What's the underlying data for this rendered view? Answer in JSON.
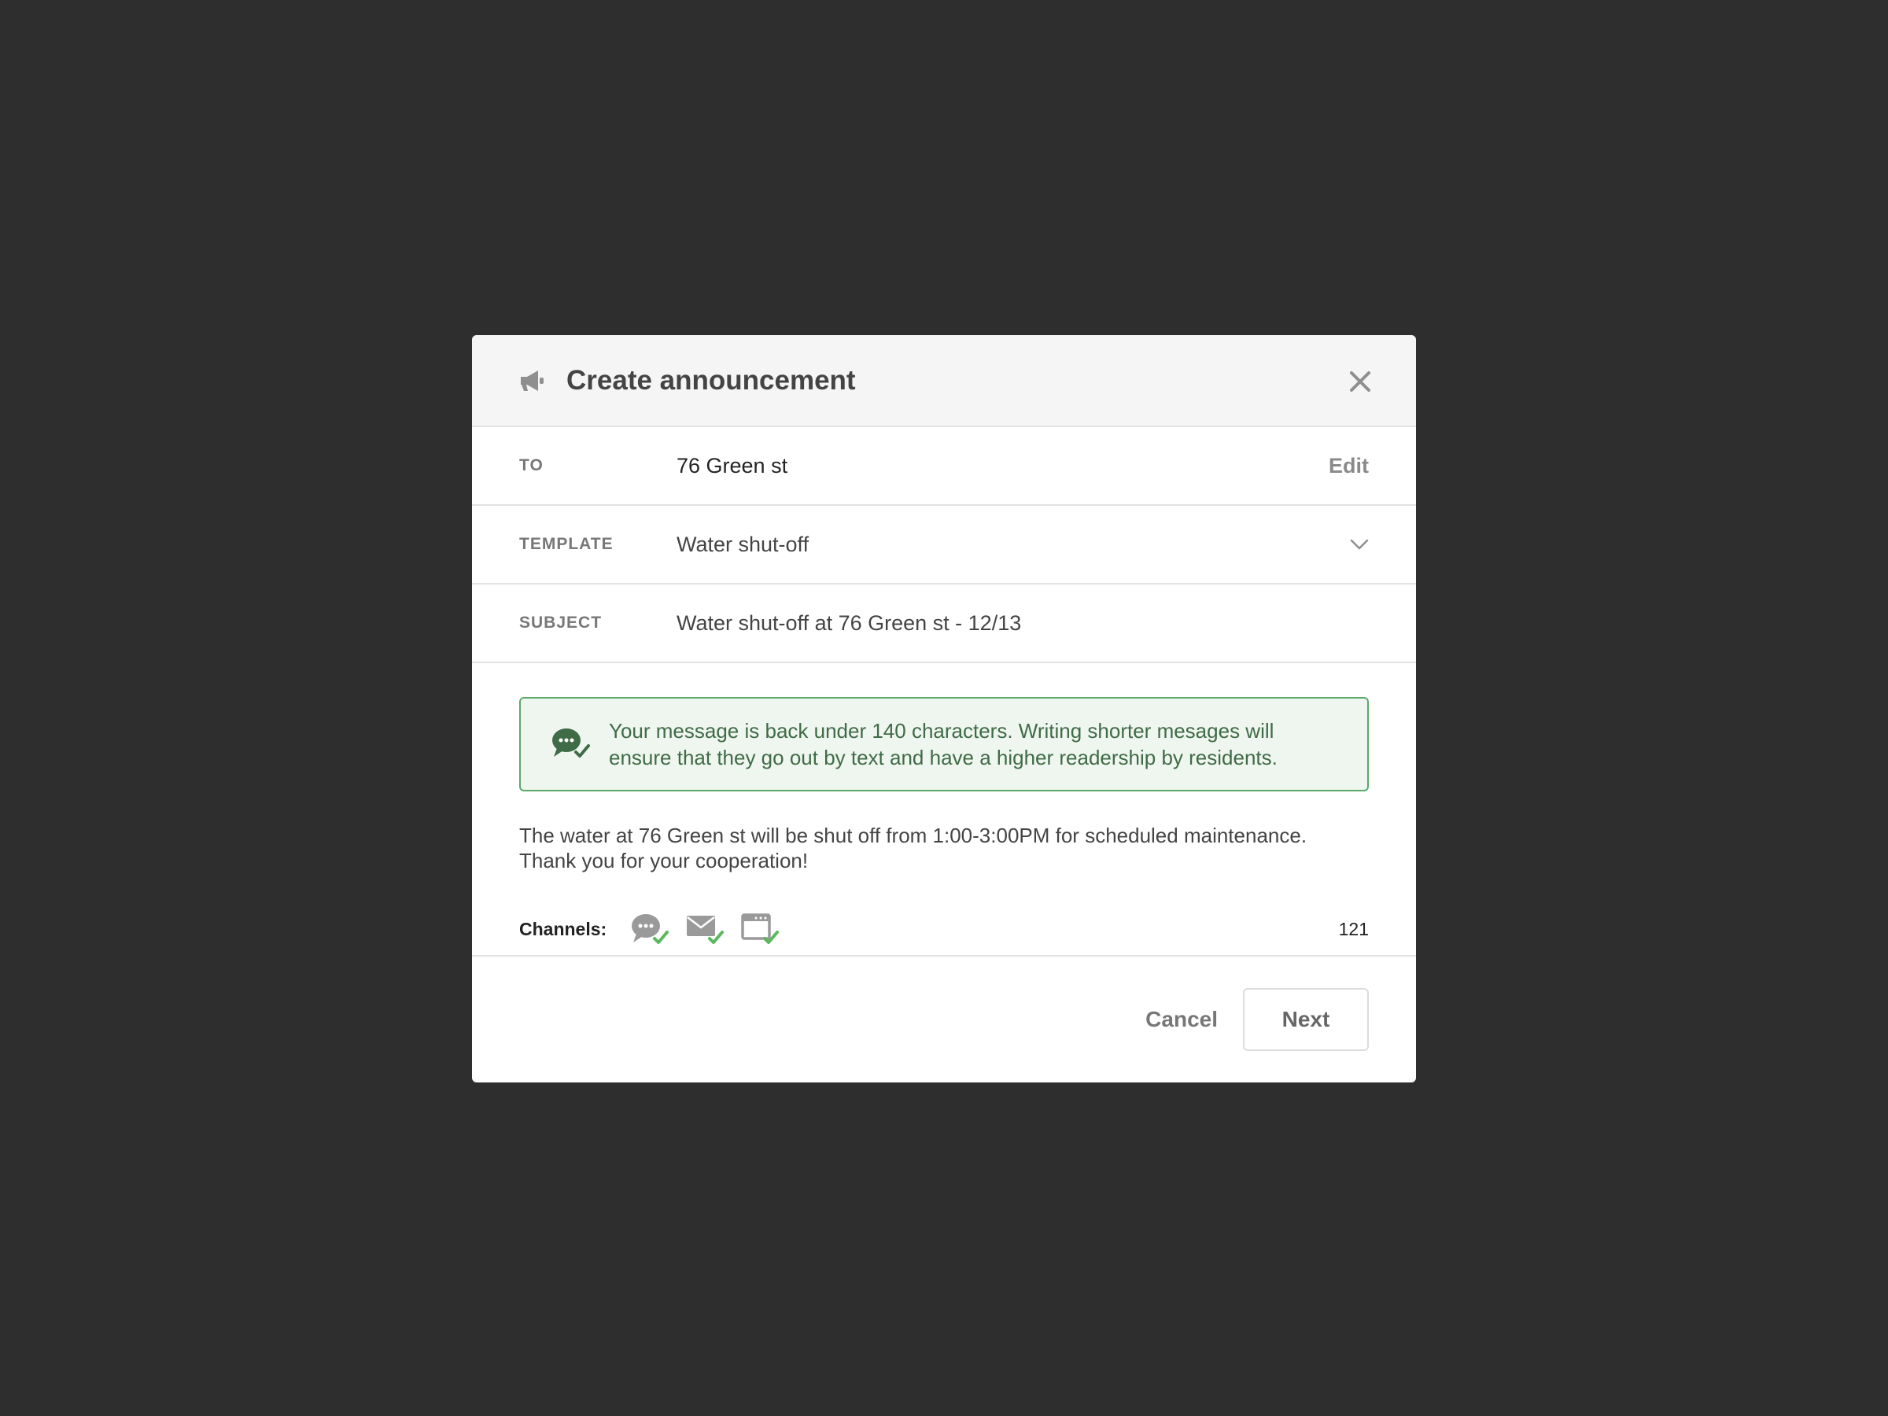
{
  "header": {
    "title": "Create announcement",
    "icon": "megaphone-icon",
    "close_icon": "close-icon"
  },
  "to": {
    "label": "TO",
    "value": "76 Green st",
    "action": "Edit"
  },
  "template": {
    "label": "TEMPLATE",
    "value": "Water shut-off",
    "icon": "chevron-down-icon"
  },
  "subject": {
    "label": "SUBJECT",
    "value": "Water shut-off at 76 Green st - 12/13"
  },
  "notice": {
    "icon": "chat-check-icon",
    "text": "Your message is back under 140 characters. Writing shorter mesages will ensure that they go out by text and have a higher readership by residents."
  },
  "message": {
    "line1": "The water at 76 Green st will be shut off from 1:00-3:00PM for scheduled maintenance.",
    "line2": "Thank you for your cooperation!"
  },
  "channels": {
    "label": "Channels:",
    "items": [
      {
        "icon": "sms-chat-icon",
        "checked": true
      },
      {
        "icon": "email-icon",
        "checked": true
      },
      {
        "icon": "web-browser-icon",
        "checked": true
      }
    ],
    "char_count": "121"
  },
  "footer": {
    "cancel_label": "Cancel",
    "next_label": "Next"
  },
  "colors": {
    "backdrop": "#2e2e2e",
    "header_bg": "#f5f5f5",
    "notice_bg": "#eff6ef",
    "notice_border": "#5aa968",
    "notice_text": "#3f6b47",
    "check_green": "#5cb85c"
  }
}
